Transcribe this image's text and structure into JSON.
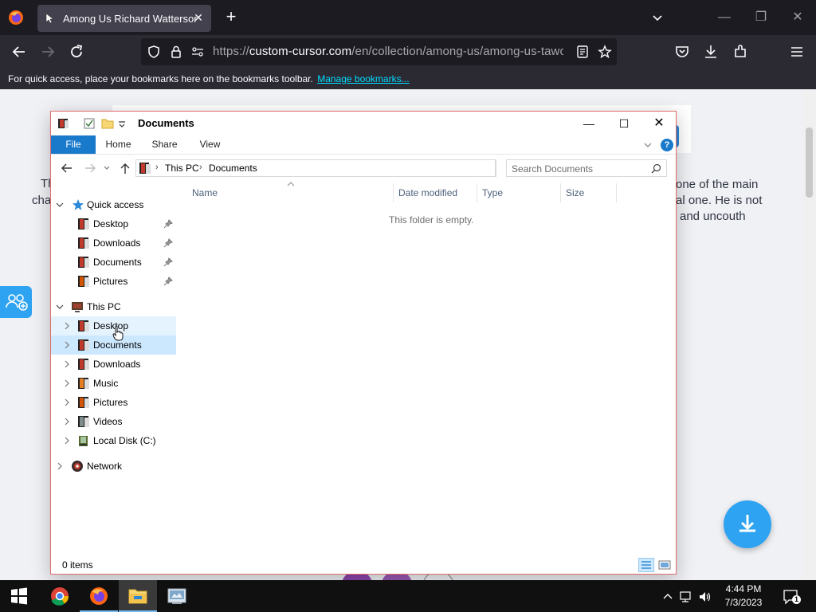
{
  "browser": {
    "tab_title": "Among Us Richard Watterson",
    "url_prefix": "https://",
    "url_host": "custom-cursor.com",
    "url_path": "/en/collection/among-us/among-us-tawog-",
    "bookmarks_message": "For quick access, place your bookmarks here on the bookmarks toolbar.",
    "bookmarks_link": "Manage bookmarks..."
  },
  "page": {
    "left_fragment_1": "Th",
    "left_fragment_2": "cha",
    "right_fragment_1": "one of the main",
    "right_fragment_2": "al one. He is not",
    "right_fragment_3": "and uncouth"
  },
  "explorer": {
    "title": "Documents",
    "ribbon_tabs": [
      "File",
      "Home",
      "Share",
      "View"
    ],
    "help": "?",
    "breadcrumb": [
      "This PC",
      "Documents"
    ],
    "search_placeholder": "Search Documents",
    "nav": {
      "quick_access": "Quick access",
      "quick_items": [
        "Desktop",
        "Downloads",
        "Documents",
        "Pictures"
      ],
      "this_pc": "This PC",
      "pc_items": [
        "Desktop",
        "Documents",
        "Downloads",
        "Music",
        "Pictures",
        "Videos",
        "Local Disk (C:)"
      ],
      "network": "Network"
    },
    "columns": [
      "Name",
      "Date modified",
      "Type",
      "Size"
    ],
    "empty_message": "This folder is empty.",
    "status": "0 items"
  },
  "taskbar": {
    "time": "4:44 PM",
    "date": "7/3/2023",
    "notification_count": "1"
  },
  "colors": {
    "accent": "#1979ca",
    "selection": "#cce8ff",
    "page_blue": "#2ea3f2",
    "window_border": "#e06b6b"
  }
}
